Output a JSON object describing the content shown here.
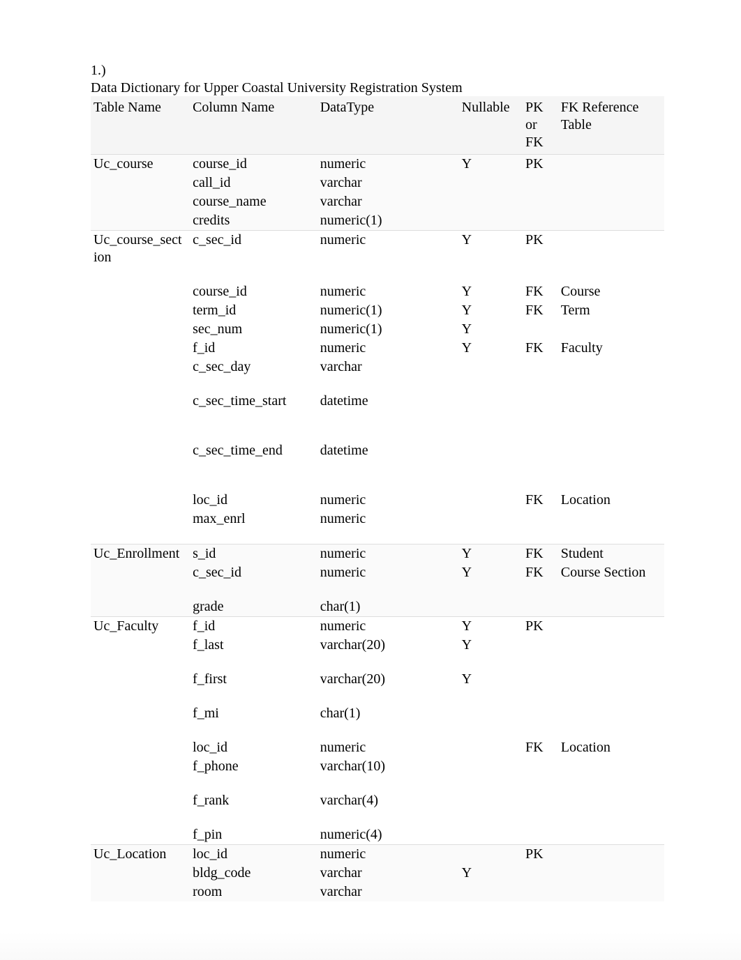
{
  "question_number": "1.)",
  "title": "Data Dictionary for Upper Coastal University Registration System",
  "headers": {
    "table_name": "Table Name",
    "column_name": "Column Name",
    "datatype": "DataType",
    "nullable": "Nullable",
    "pk_or_fk": "PK or FK",
    "fk_reference": "FK Reference Table"
  },
  "rows": [
    {
      "table": "Uc_course",
      "column": "course_id",
      "datatype": "numeric",
      "nullable": "Y",
      "pkfk": "PK",
      "fkref": "",
      "groupstart": true,
      "alt": true
    },
    {
      "table": "",
      "column": "call_id",
      "datatype": "varchar",
      "nullable": "",
      "pkfk": "",
      "fkref": "",
      "alt": true
    },
    {
      "table": "",
      "column": "course_name",
      "datatype": "varchar",
      "nullable": "",
      "pkfk": "",
      "fkref": "",
      "alt": true
    },
    {
      "table": "",
      "column": "credits",
      "datatype": "numeric(1)",
      "nullable": "",
      "pkfk": "",
      "fkref": "",
      "alt": true
    },
    {
      "table": "Uc_course_section",
      "column": "c_sec_id",
      "datatype": "numeric",
      "nullable": "Y",
      "pkfk": "PK",
      "fkref": "",
      "groupstart": true
    },
    {
      "gap": true
    },
    {
      "table": "",
      "column": "course_id",
      "datatype": "numeric",
      "nullable": "Y",
      "pkfk": "FK",
      "fkref": "Course"
    },
    {
      "table": "",
      "column": "term_id",
      "datatype": "numeric(1)",
      "nullable": "Y",
      "pkfk": "FK",
      "fkref": "Term"
    },
    {
      "table": "",
      "column": "sec_num",
      "datatype": "numeric(1)",
      "nullable": "Y",
      "pkfk": "",
      "fkref": ""
    },
    {
      "table": "",
      "column": "f_id",
      "datatype": "numeric",
      "nullable": "Y",
      "pkfk": "FK",
      "fkref": "Faculty"
    },
    {
      "table": "",
      "column": "c_sec_day",
      "datatype": "varchar",
      "nullable": "",
      "pkfk": "",
      "fkref": ""
    },
    {
      "gap": true
    },
    {
      "table": "",
      "column": "c_sec_time_start",
      "datatype": "datetime",
      "nullable": "",
      "pkfk": "",
      "fkref": ""
    },
    {
      "gap": true
    },
    {
      "gap": true
    },
    {
      "table": "",
      "column": "c_sec_time_end",
      "datatype": "datetime",
      "nullable": "",
      "pkfk": "",
      "fkref": ""
    },
    {
      "gap": true
    },
    {
      "gap": true
    },
    {
      "table": "",
      "column": "loc_id",
      "datatype": "numeric",
      "nullable": "",
      "pkfk": "FK",
      "fkref": "Location"
    },
    {
      "table": "",
      "column": "max_enrl",
      "datatype": "numeric",
      "nullable": "",
      "pkfk": "",
      "fkref": ""
    },
    {
      "gap": true
    },
    {
      "table": "Uc_Enrollment",
      "column": "s_id",
      "datatype": "numeric",
      "nullable": "Y",
      "pkfk": "FK",
      "fkref": "Student",
      "groupstart": true,
      "alt": true
    },
    {
      "table": "",
      "column": "c_sec_id",
      "datatype": "numeric",
      "nullable": "Y",
      "pkfk": "FK",
      "fkref": "Course Section",
      "alt": true
    },
    {
      "gap": true,
      "alt": true
    },
    {
      "table": "",
      "column": "grade",
      "datatype": "char(1)",
      "nullable": "",
      "pkfk": "",
      "fkref": "",
      "alt": true
    },
    {
      "table": "Uc_Faculty",
      "column": "f_id",
      "datatype": "numeric",
      "nullable": "Y",
      "pkfk": "PK",
      "fkref": "",
      "groupstart": true
    },
    {
      "table": "",
      "column": "f_last",
      "datatype": "varchar(20)",
      "nullable": "Y",
      "pkfk": "",
      "fkref": ""
    },
    {
      "gap": true
    },
    {
      "table": "",
      "column": "f_first",
      "datatype": "varchar(20)",
      "nullable": "Y",
      "pkfk": "",
      "fkref": ""
    },
    {
      "gap": true
    },
    {
      "table": "",
      "column": "f_mi",
      "datatype": "char(1)",
      "nullable": "",
      "pkfk": "",
      "fkref": ""
    },
    {
      "gap": true
    },
    {
      "table": "",
      "column": "loc_id",
      "datatype": "numeric",
      "nullable": "",
      "pkfk": "FK",
      "fkref": "Location"
    },
    {
      "table": "",
      "column": "f_phone",
      "datatype": "varchar(10)",
      "nullable": "",
      "pkfk": "",
      "fkref": ""
    },
    {
      "gap": true
    },
    {
      "table": "",
      "column": "f_rank",
      "datatype": "varchar(4)",
      "nullable": "",
      "pkfk": "",
      "fkref": ""
    },
    {
      "gap": true
    },
    {
      "table": "",
      "column": "f_pin",
      "datatype": "numeric(4)",
      "nullable": "",
      "pkfk": "",
      "fkref": ""
    },
    {
      "table": "Uc_Location",
      "column": "loc_id",
      "datatype": "numeric",
      "nullable": "",
      "pkfk": "PK",
      "fkref": "",
      "groupstart": true,
      "alt": true
    },
    {
      "table": "",
      "column": "bldg_code",
      "datatype": "varchar",
      "nullable": "Y",
      "pkfk": "",
      "fkref": "",
      "alt": true
    },
    {
      "table": "",
      "column": "room",
      "datatype": "varchar",
      "nullable": "",
      "pkfk": "",
      "fkref": "",
      "alt": true
    }
  ]
}
